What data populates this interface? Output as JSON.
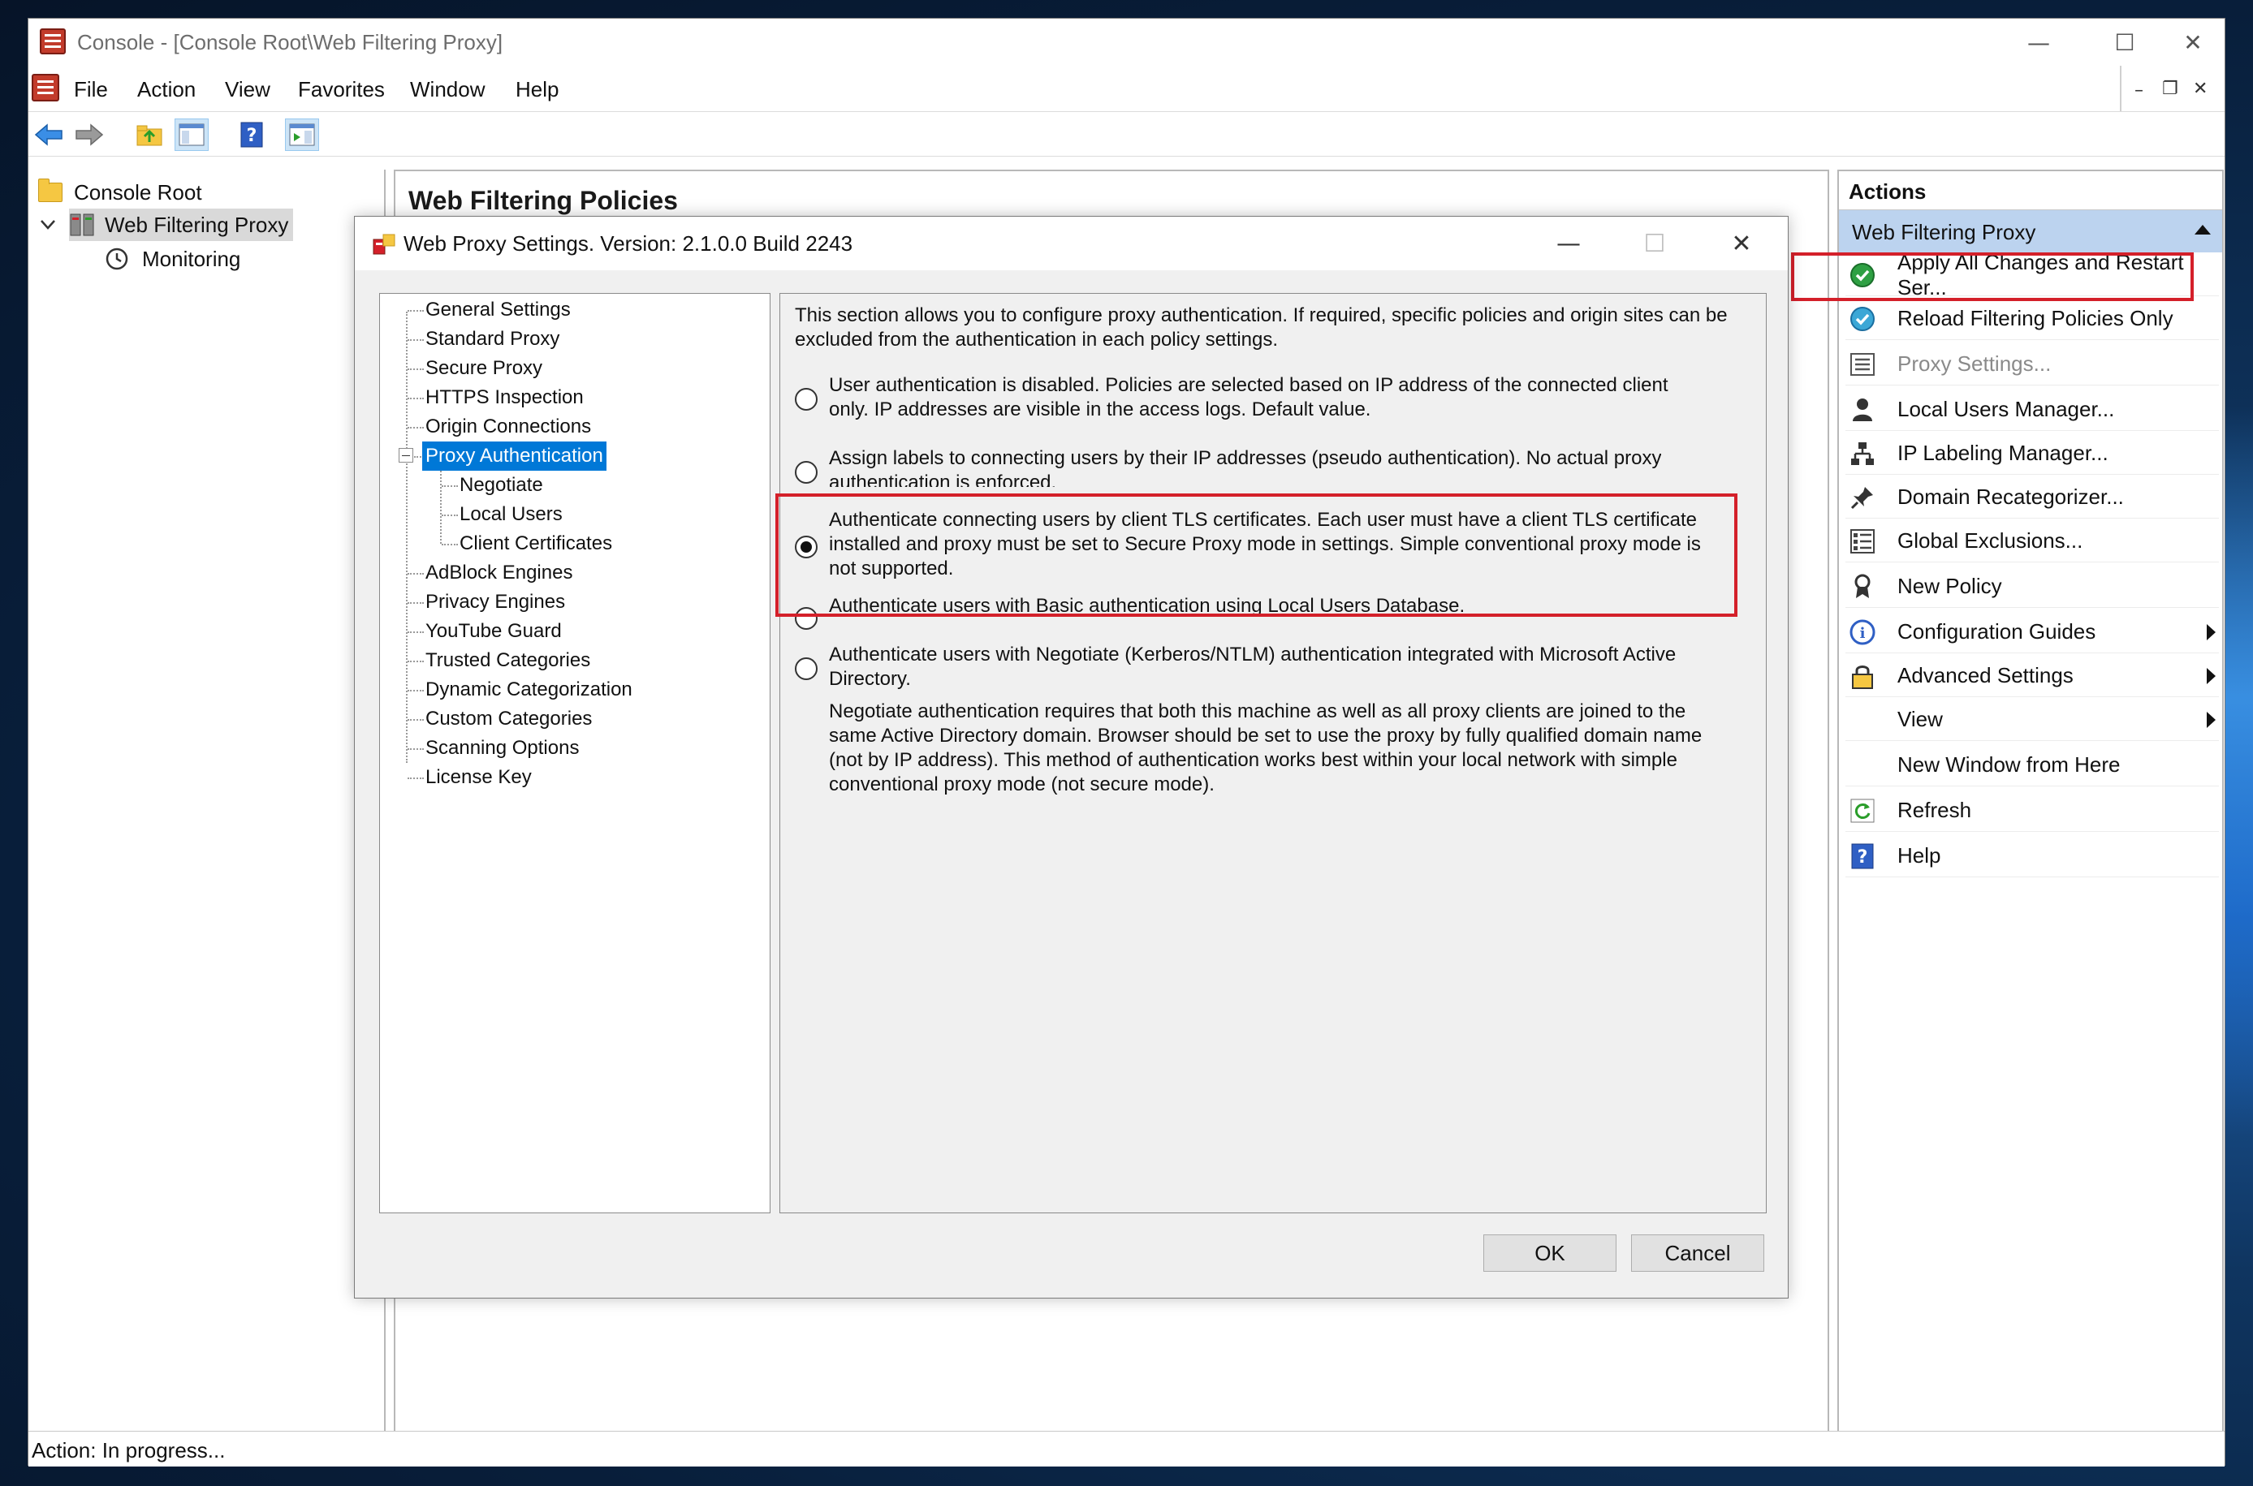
{
  "window": {
    "title": "Console - [Console Root\\Web Filtering Proxy]",
    "controls": {
      "minimize": "—",
      "maximize": "☐",
      "close": "✕"
    }
  },
  "menubar": {
    "items": [
      "File",
      "Action",
      "View",
      "Favorites",
      "Window",
      "Help"
    ],
    "mdi_controls": {
      "minimize": "–",
      "restore": "❐",
      "close": "✕"
    }
  },
  "toolbar": {
    "buttons": [
      "back-arrow-icon",
      "forward-arrow-icon",
      "up-folder-icon",
      "show-hide-tree-icon",
      "help-icon",
      "show-hide-action-pane-icon"
    ]
  },
  "tree": {
    "root": "Console Root",
    "items": [
      {
        "label": "Web Filtering Proxy",
        "selected": true
      },
      {
        "label": "Monitoring"
      }
    ]
  },
  "center": {
    "title": "Web Filtering Policies"
  },
  "actions": {
    "header": "Actions",
    "group": "Web Filtering Proxy",
    "items": [
      {
        "label": "Apply All Changes and Restart Ser...",
        "icon": "green-check-icon"
      },
      {
        "label": "Reload Filtering Policies Only",
        "icon": "blue-check-icon"
      },
      {
        "label": "Proxy Settings...",
        "icon": "list-icon",
        "disabled": true
      },
      {
        "label": "Local Users Manager...",
        "icon": "user-icon"
      },
      {
        "label": "IP Labeling Manager...",
        "icon": "network-icon"
      },
      {
        "label": "Domain Recategorizer...",
        "icon": "pin-icon"
      },
      {
        "label": "Global Exclusions...",
        "icon": "exclusions-icon"
      },
      {
        "label": "New Policy",
        "icon": "ribbon-icon"
      },
      {
        "label": "Configuration Guides",
        "icon": "info-icon",
        "submenu": true
      },
      {
        "label": "Advanced Settings",
        "icon": "lock-icon",
        "submenu": true
      },
      {
        "label": "View",
        "icon": "",
        "submenu": true
      },
      {
        "label": "New Window from Here",
        "icon": ""
      },
      {
        "label": "Refresh",
        "icon": "refresh-icon"
      },
      {
        "label": "Help",
        "icon": "help-icon"
      }
    ]
  },
  "status": {
    "text": "Action:  In progress..."
  },
  "dialog": {
    "title": "Web Proxy Settings. Version: 2.1.0.0 Build 2243",
    "controls": {
      "minimize": "—",
      "maximize": "☐",
      "close": "✕"
    },
    "tree": [
      {
        "label": "General Settings",
        "level": 0
      },
      {
        "label": "Standard Proxy",
        "level": 0
      },
      {
        "label": "Secure Proxy",
        "level": 0
      },
      {
        "label": "HTTPS Inspection",
        "level": 0
      },
      {
        "label": "Origin Connections",
        "level": 0
      },
      {
        "label": "Proxy Authentication",
        "level": 0,
        "selected": true,
        "expanded": true
      },
      {
        "label": "Negotiate",
        "level": 1
      },
      {
        "label": "Local Users",
        "level": 1
      },
      {
        "label": "Client Certificates",
        "level": 1
      },
      {
        "label": "AdBlock Engines",
        "level": 0
      },
      {
        "label": "Privacy Engines",
        "level": 0
      },
      {
        "label": "YouTube Guard",
        "level": 0
      },
      {
        "label": "Trusted Categories",
        "level": 0
      },
      {
        "label": "Dynamic Categorization",
        "level": 0
      },
      {
        "label": "Custom Categories",
        "level": 0
      },
      {
        "label": "Scanning Options",
        "level": 0
      },
      {
        "label": "License Key",
        "level": 0
      }
    ],
    "intro": [
      "This section allows you to configure proxy authentication.  If required, specific policies and origin sites can be",
      "excluded from the authentication in each policy settings."
    ],
    "options": [
      {
        "lines": [
          "User authentication is disabled. Policies are selected based on IP address of the connected client",
          "only. IP addresses are visible in the access logs. Default value."
        ],
        "checked": false
      },
      {
        "lines": [
          "Assign labels to connecting users by their IP addresses (pseudo authentication). No actual proxy",
          "authentication is enforced."
        ],
        "checked": false
      },
      {
        "lines": [
          "Authenticate connecting users by client TLS certificates. Each user must have a client TLS certificate",
          "installed and proxy must be set to Secure Proxy mode in settings. Simple conventional proxy mode is",
          "not supported."
        ],
        "checked": true
      },
      {
        "lines": [
          "Authenticate users with Basic authentication using Local Users Database."
        ],
        "checked": false
      },
      {
        "lines": [
          "Authenticate users with Negotiate (Kerberos/NTLM) authentication integrated with Microsoft Active",
          "Directory."
        ],
        "checked": false
      }
    ],
    "note": [
      "Negotiate authentication requires that both this machine as well as all proxy clients are joined to the",
      "same Active Directory domain. Browser should be set to use the proxy by fully qualified domain name",
      "(not by IP address). This method of authentication works best within your local network with simple",
      "conventional proxy mode (not secure mode)."
    ],
    "ok_label": "OK",
    "cancel_label": "Cancel"
  }
}
